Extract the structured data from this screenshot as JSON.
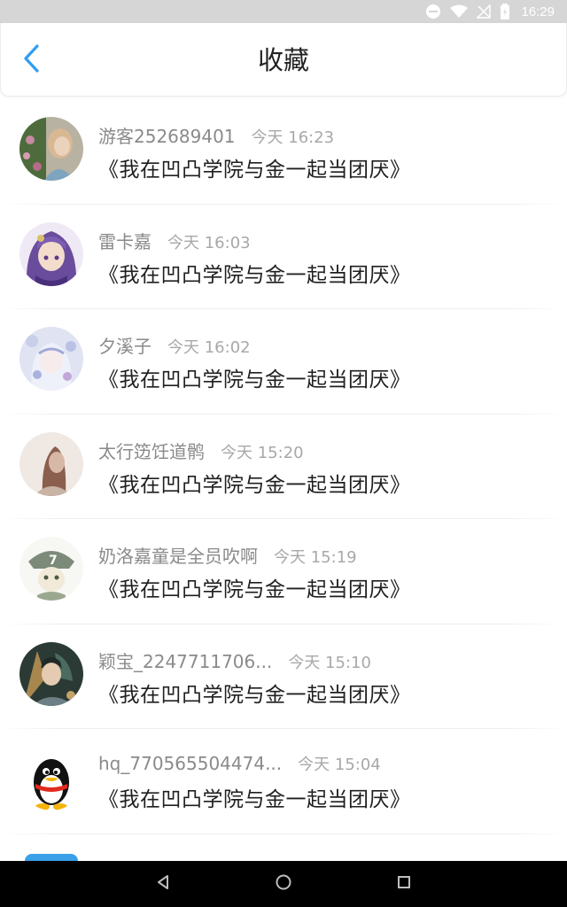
{
  "status_bar": {
    "time": "16:29"
  },
  "header": {
    "title": "收藏"
  },
  "items": [
    {
      "username": "游客252689401",
      "time": "今天 16:23",
      "work": "《我在凹凸学院与金一起当团厌》"
    },
    {
      "username": "雷卡嘉",
      "time": "今天 16:03",
      "work": "《我在凹凸学院与金一起当团厌》"
    },
    {
      "username": "夕溪子",
      "time": "今天 16:02",
      "work": "《我在凹凸学院与金一起当团厌》"
    },
    {
      "username": "太行笾饪道鹘",
      "time": "今天 15:20",
      "work": "《我在凹凸学院与金一起当团厌》"
    },
    {
      "username": "奶洛嘉童是全员吹啊",
      "time": "今天 15:19",
      "work": "《我在凹凸学院与金一起当团厌》"
    },
    {
      "username": "颖宝_2247711706...",
      "time": "今天 15:10",
      "work": "《我在凹凸学院与金一起当团厌》"
    },
    {
      "username": "hq_770565504474...",
      "time": "今天 15:04",
      "work": "《我在凹凸学院与金一起当团厌》"
    }
  ],
  "colors": {
    "accent": "#2f9df4",
    "username": "#8a8a8a",
    "timestamp": "#a8a8a8"
  }
}
